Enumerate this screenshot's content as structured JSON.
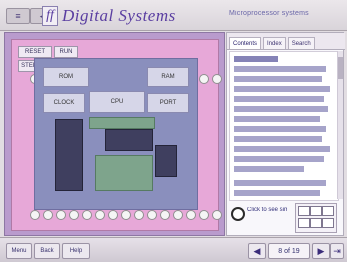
{
  "app": {
    "title": "Digital Systems",
    "logo_glyph": "ff",
    "subtitle": "Microprocessor systems"
  },
  "top": {
    "left_btn": "≡",
    "right_btn": "◂"
  },
  "board": {
    "buttons": [
      "RESET",
      "RUN",
      "STEP"
    ],
    "labels": [
      "ROM",
      "RAM",
      "CPU",
      "PORT",
      "CLOCK"
    ]
  },
  "right_panel": {
    "tabs": [
      "Contents",
      "Index",
      "Search"
    ],
    "footer_text": "Click to see simulation"
  },
  "bottom": {
    "buttons": [
      "Menu",
      "Back",
      "Help"
    ],
    "page": "8 of 19",
    "prev_arrow": "◀",
    "next_arrow": "▶",
    "end_arrow": "⇥"
  }
}
